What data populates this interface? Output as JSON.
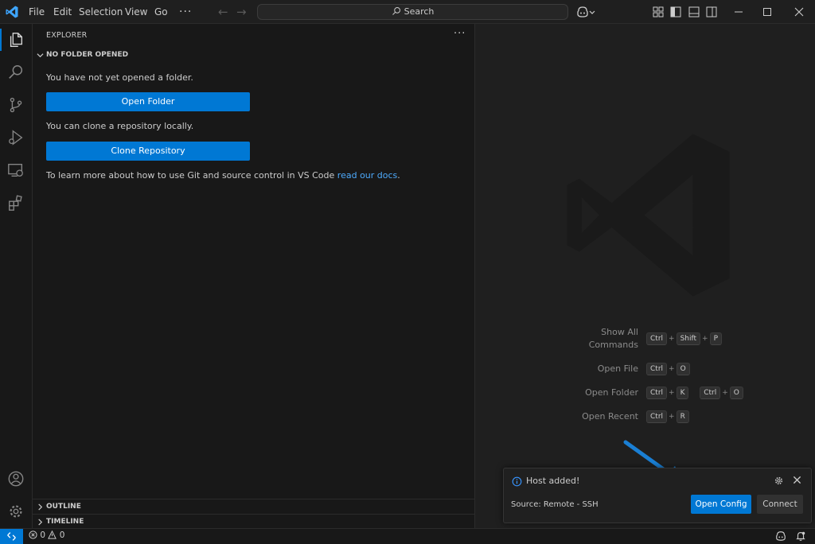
{
  "menu": [
    "File",
    "Edit",
    "Selection",
    "View",
    "Go"
  ],
  "menu_more": "···",
  "search": {
    "label": "Search"
  },
  "sidebar": {
    "title": "EXPLORER",
    "more": "···",
    "section": "NO FOLDER OPENED",
    "not_opened_text": "You have not yet opened a folder.",
    "open_folder_button": "Open Folder",
    "clone_text": "You can clone a repository locally.",
    "clone_button": "Clone Repository",
    "learn_text": "To learn more about how to use Git and source control in VS Code ",
    "learn_link": "read our docs",
    "learn_end": ".",
    "outline": "OUTLINE",
    "timeline": "TIMELINE"
  },
  "shortcuts": [
    {
      "label_lines": [
        "Show All",
        "Commands"
      ],
      "keys": [
        [
          "Ctrl",
          "Shift",
          "P"
        ]
      ]
    },
    {
      "label_lines": [
        "Open File"
      ],
      "keys": [
        [
          "Ctrl",
          "O"
        ]
      ]
    },
    {
      "label_lines": [
        "Open Folder"
      ],
      "keys": [
        [
          "Ctrl",
          "K"
        ],
        [
          "Ctrl",
          "O"
        ]
      ]
    },
    {
      "label_lines": [
        "Open Recent"
      ],
      "keys": [
        [
          "Ctrl",
          "R"
        ]
      ]
    }
  ],
  "notification": {
    "message": "Host added!",
    "source": "Source: Remote - SSH",
    "primary_button": "Open Config",
    "secondary_button": "Connect"
  },
  "status": {
    "errors": "0",
    "warnings": "0"
  },
  "colors": {
    "accent": "#0078d4",
    "link": "#4daafc",
    "background": "#181818",
    "editor": "#1f1f1f"
  }
}
